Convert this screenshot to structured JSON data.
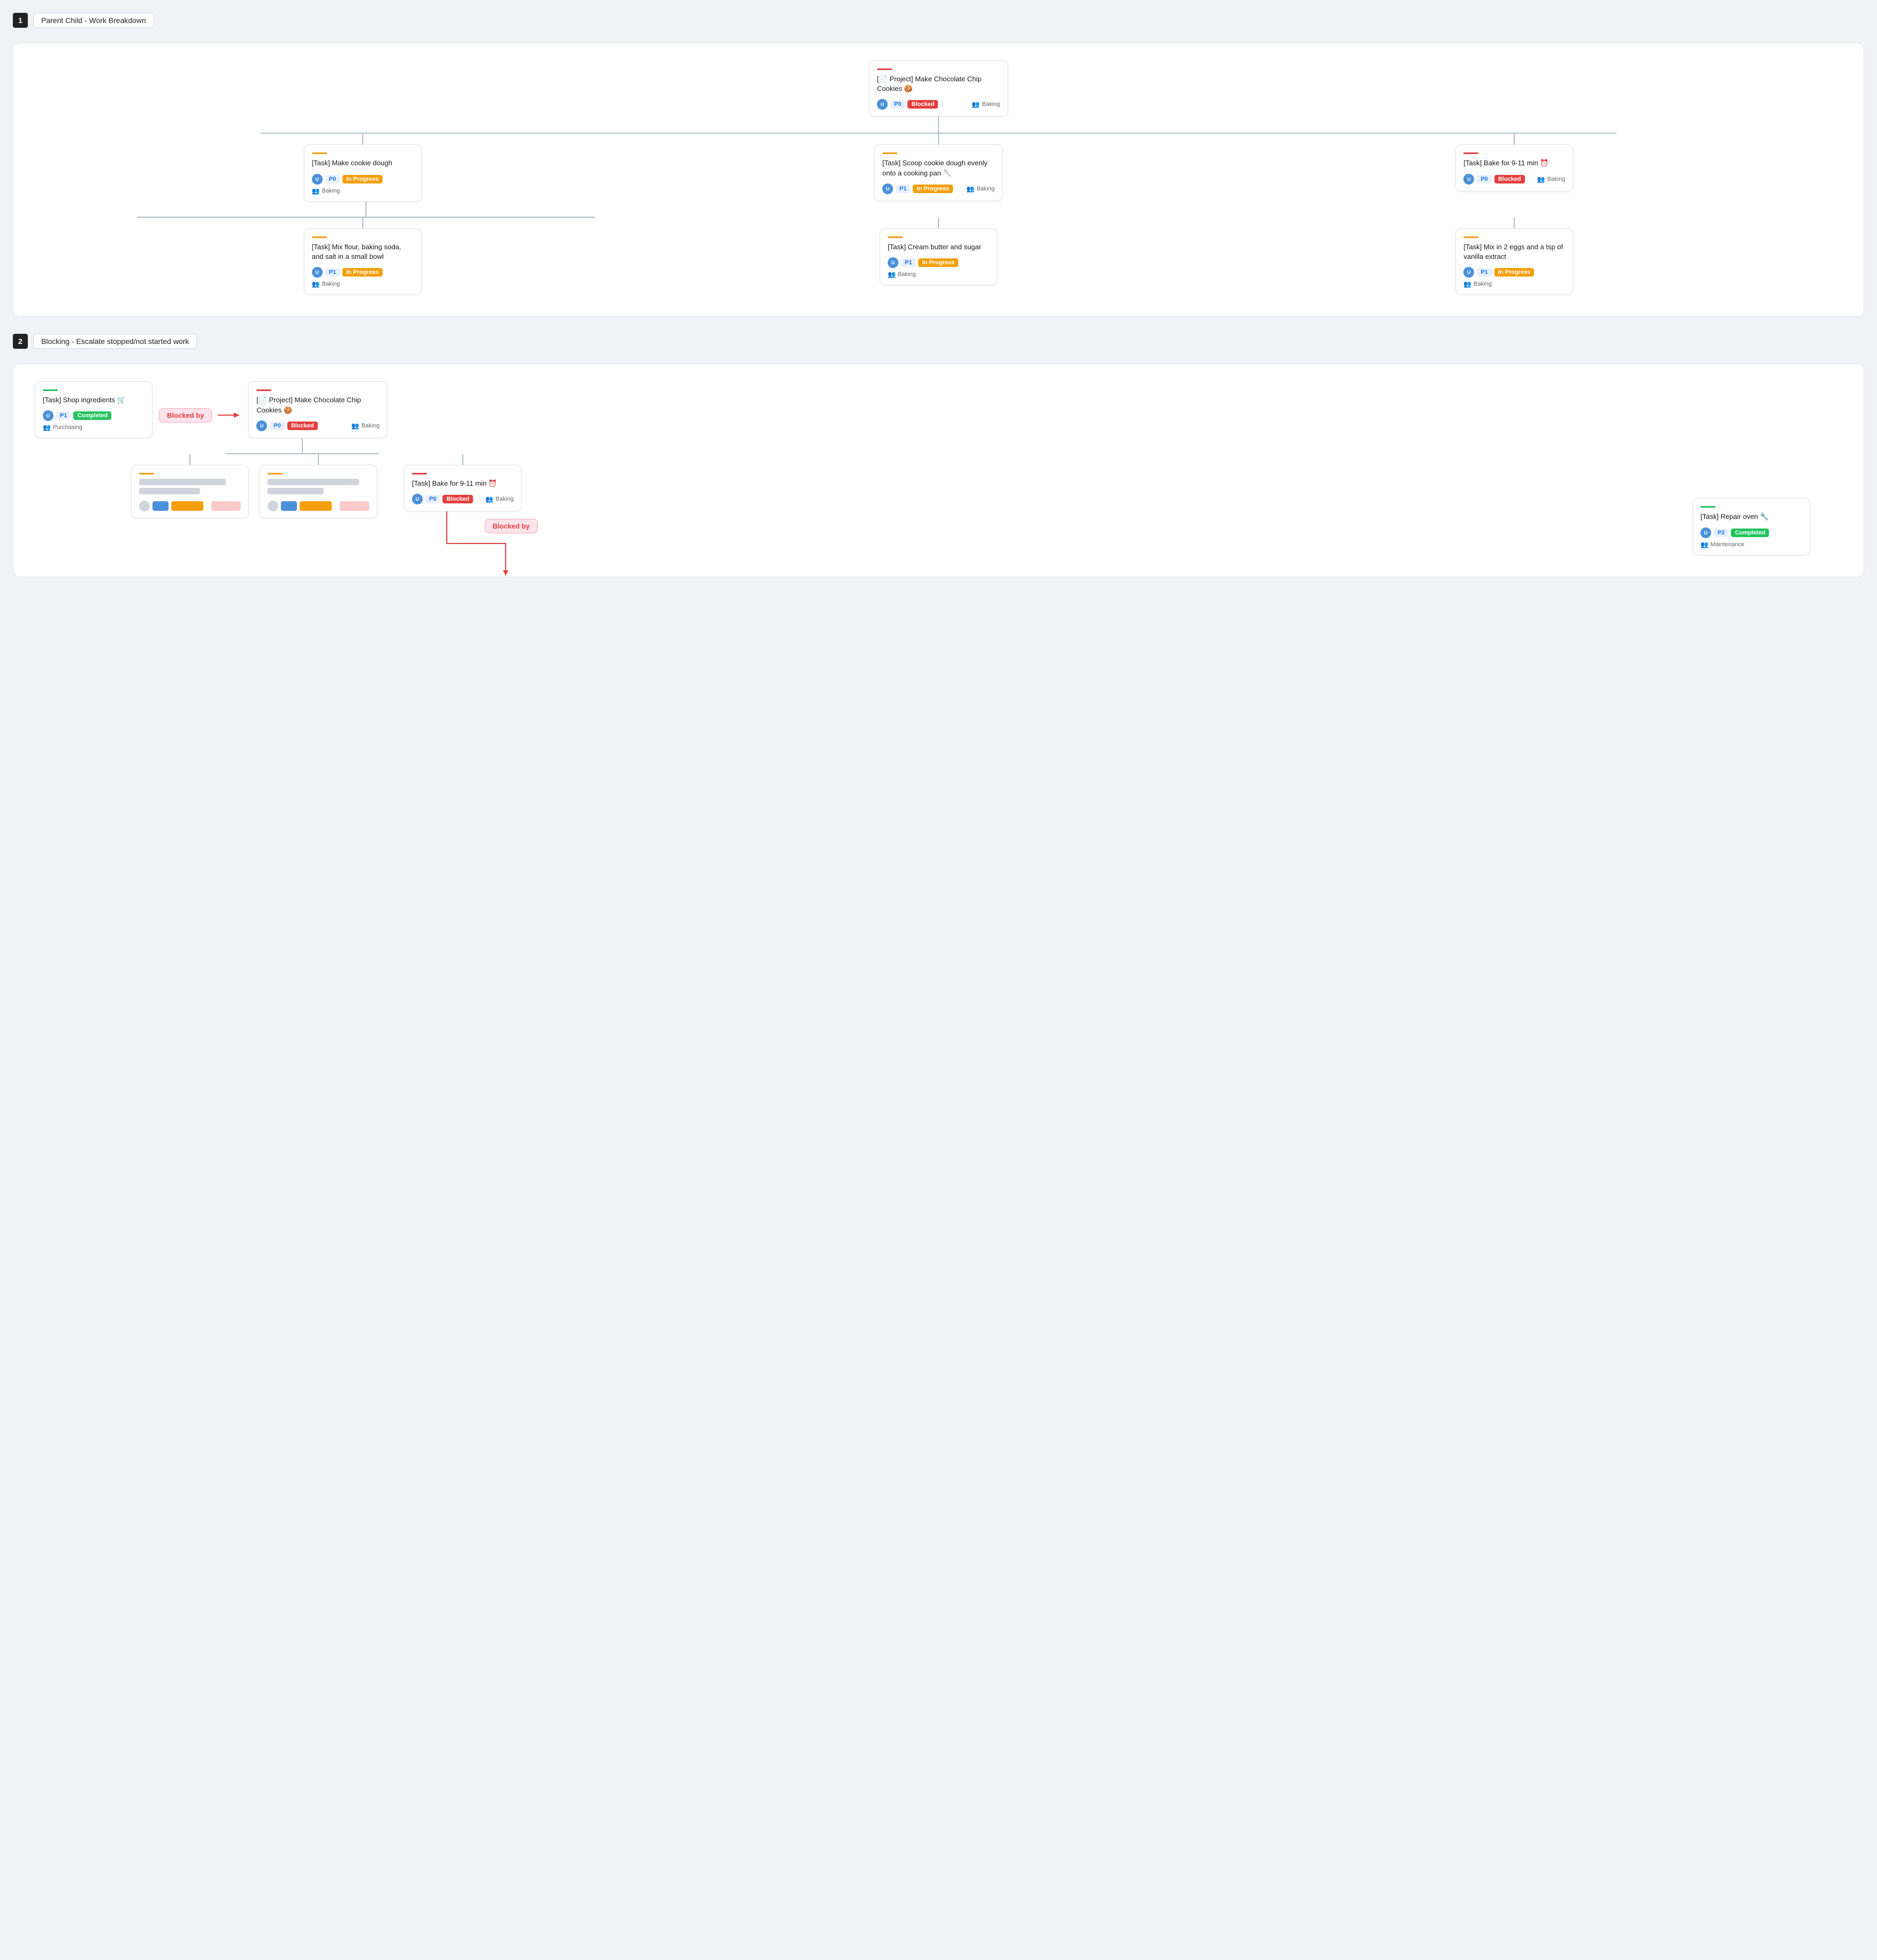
{
  "sections": [
    {
      "number": "1",
      "title": "Parent Child - Work Breakdown",
      "root_card": {
        "accent": "#e53e3e",
        "title": "[📄 Project] Make Chocolate Chip Cookies 🍪",
        "avatar_class": "avatar-blue",
        "avatar_text": "U",
        "priority": "P0",
        "priority_class": "badge-p0",
        "status": "Blocked",
        "status_class": "badge-blocked",
        "team": "Baking"
      },
      "level1": [
        {
          "accent": "#f59e0b",
          "title": "[Task] Make cookie dough",
          "priority": "P0",
          "priority_class": "badge-p0",
          "status": "In Progress",
          "status_class": "badge-inprogress",
          "team": "Baking",
          "has_children": true
        },
        {
          "accent": "#f59e0b",
          "title": "[Task] Scoop cookie dough evenly onto a cooking pan 🥄",
          "priority": "P1",
          "priority_class": "badge-p1",
          "status": "In Progress",
          "status_class": "badge-inprogress",
          "team": "Baking",
          "has_children": false
        },
        {
          "accent": "#e53e3e",
          "title": "[Task] Bake for 9-11 min ⏰",
          "priority": "P0",
          "priority_class": "badge-p0",
          "status": "Blocked",
          "status_class": "badge-blocked",
          "team": "Baking",
          "has_children": false
        }
      ],
      "level2": [
        {
          "accent": "#f59e0b",
          "title": "[Task] Mix flour, baking soda, and salt in a small bowl",
          "priority": "P1",
          "priority_class": "badge-p1",
          "status": "In Progress",
          "status_class": "badge-inprogress",
          "team": "Baking"
        },
        {
          "accent": "#f59e0b",
          "title": "[Task] Cream butter and sugar",
          "priority": "P1",
          "priority_class": "badge-p1",
          "status": "In Progress",
          "status_class": "badge-inprogress",
          "team": "Baking"
        },
        {
          "accent": "#f59e0b",
          "title": "[Task] Mix in 2 eggs and a tsp of vanilla extract",
          "priority": "P1",
          "priority_class": "badge-p1",
          "status": "In Progress",
          "status_class": "badge-inprogress",
          "team": "Baking"
        }
      ]
    },
    {
      "number": "2",
      "title": "Blocking - Escalate stopped/not started work",
      "shop_card": {
        "accent": "#22c55e",
        "title": "[Task] Shop ingredients 🛒",
        "priority": "P1",
        "priority_class": "badge-p1",
        "status": "Completed",
        "status_class": "badge-completed",
        "team": "Purchasing"
      },
      "blocked_by_label": "Blocked by",
      "project_card": {
        "accent": "#e53e3e",
        "title": "[📄 Project] Make Chocolate Chip Cookies 🍪",
        "priority": "P0",
        "priority_class": "badge-p0",
        "status": "Blocked",
        "status_class": "badge-blocked",
        "team": "Baking"
      },
      "bake_card": {
        "accent": "#e53e3e",
        "title": "[Task] Bake for 9-11 min ⏰",
        "priority": "P0",
        "priority_class": "badge-p0",
        "status": "Blocked",
        "status_class": "badge-blocked",
        "team": "Baking"
      },
      "repair_card": {
        "accent": "#22c55e",
        "title": "[Task] Repair oven 🔧",
        "priority": "P2",
        "priority_class": "badge-p2",
        "status": "Completed",
        "status_class": "badge-completed",
        "team": "Maintenance"
      },
      "blocked_by_label2": "Blocked by"
    }
  ]
}
